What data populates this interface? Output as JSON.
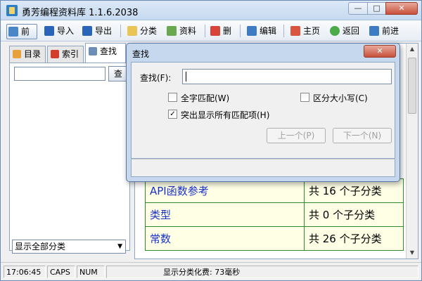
{
  "window": {
    "title": "勇芳编程资料库 1.1.6.2038"
  },
  "toolbar": {
    "front": "前",
    "import": "导入",
    "export": "导出",
    "category": "分类",
    "material": "资料",
    "delete": "删",
    "edit": "编辑",
    "home": "主页",
    "back": "返回",
    "forward": "前进"
  },
  "left": {
    "tabs": [
      {
        "label": "目录"
      },
      {
        "label": "索引"
      },
      {
        "label": "查找"
      }
    ],
    "search_button": "查",
    "category_select": "显示全部分类"
  },
  "grid": {
    "rows": [
      {
        "name": "API函数参考",
        "count": "共 16 个子分类"
      },
      {
        "name": "类型",
        "count": "共  0 个子分类"
      },
      {
        "name": "常数",
        "count": "共 26 个子分类"
      }
    ]
  },
  "dialog": {
    "title": "查找",
    "find_label": "查找(F):",
    "find_value": "",
    "whole_word": "全字匹配(W)",
    "match_case": "区分大小写(C)",
    "highlight_all": "突出显示所有匹配项(H)",
    "highlight_checked": true,
    "prev_button": "上一个(P)",
    "next_button": "下一个(N)"
  },
  "status": {
    "time": "17:06:45",
    "caps": "CAPS",
    "num": "NUM",
    "message": "显示分类化费: 73毫秒"
  }
}
